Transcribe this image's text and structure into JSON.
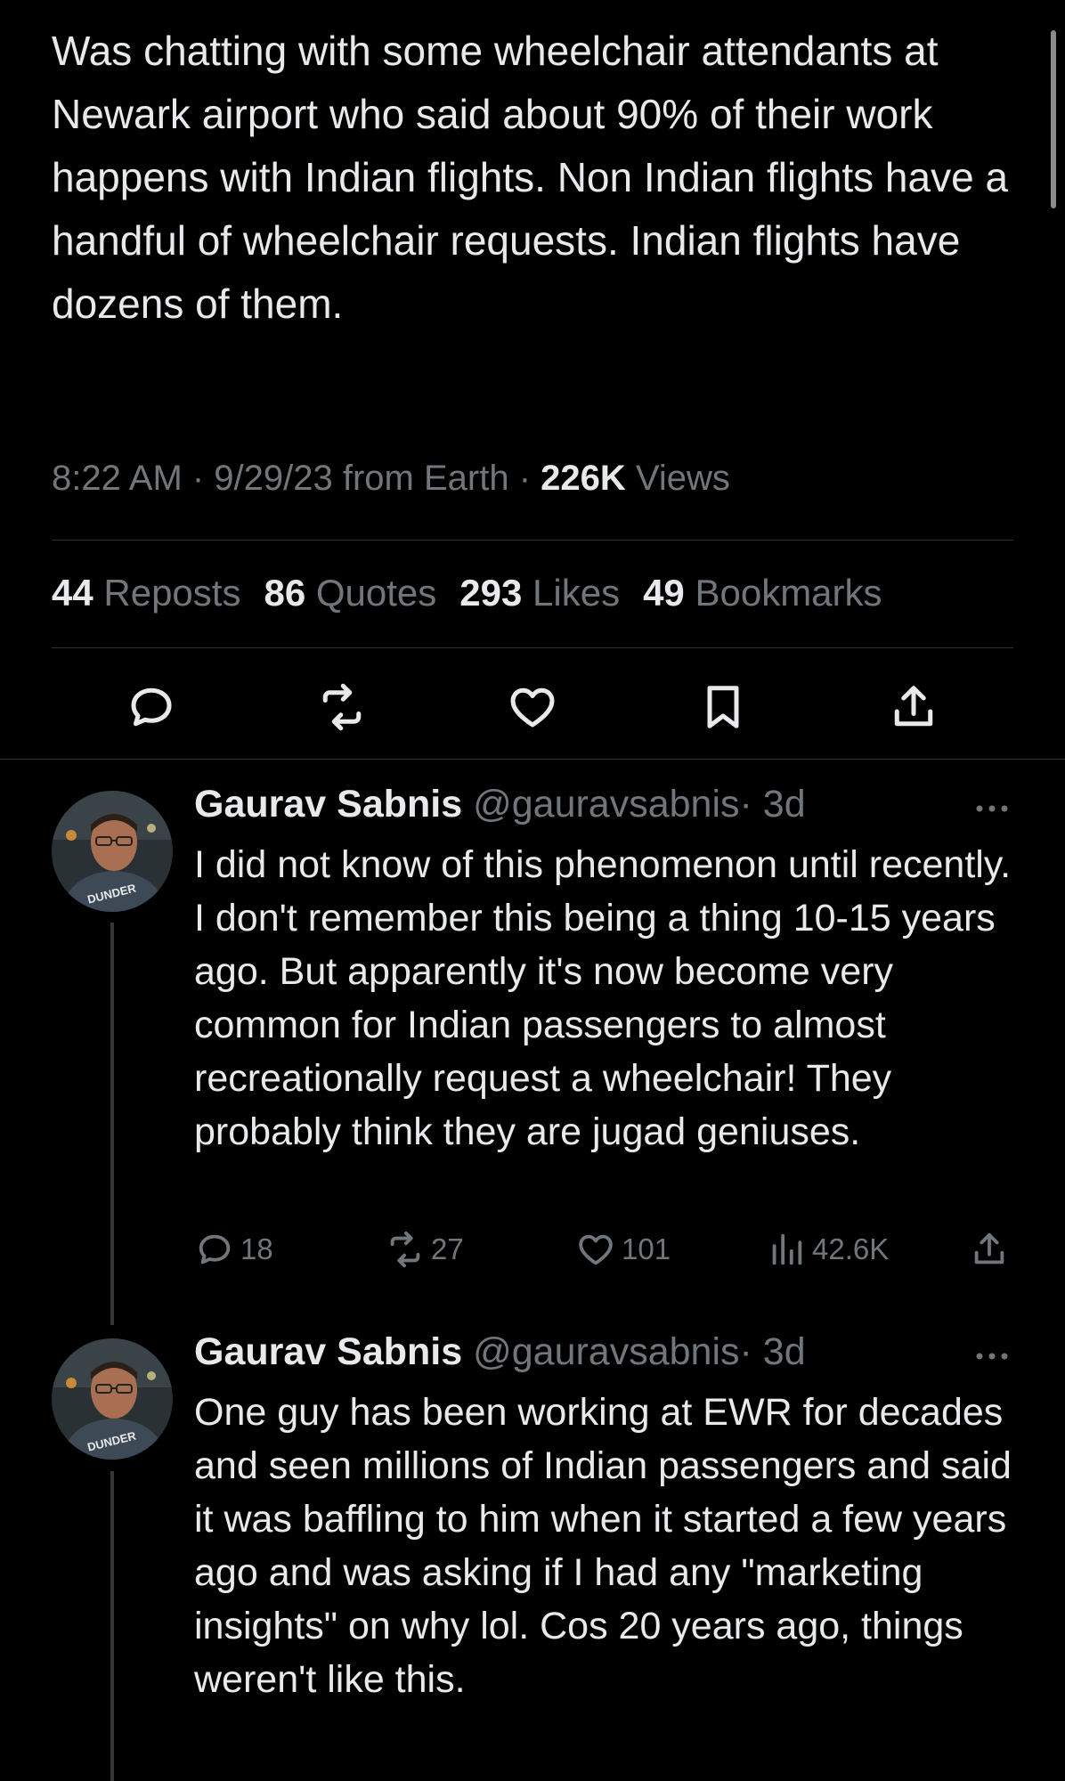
{
  "tweet": {
    "text": "Was chatting with some wheelchair attendants at Newark airport who said about 90% of their work happens with Indian flights. Non Indian flights have a handful of wheelchair requests. Indian flights have dozens of them.",
    "meta_prefix": "8:22 AM · 9/29/23 from Earth · ",
    "views_count": "226K",
    "views_label": " Views",
    "stats": {
      "reposts_count": "44",
      "reposts_label": " Reposts",
      "quotes_count": "86",
      "quotes_label": " Quotes",
      "likes_count": "293",
      "likes_label": " Likes",
      "bookmarks_count": "49",
      "bookmarks_label": " Bookmarks"
    },
    "actions": [
      "reply-icon",
      "repost-icon",
      "like-icon",
      "bookmark-icon",
      "share-icon"
    ]
  },
  "replies": [
    {
      "name": "Gaurav Sabnis",
      "handle": "@gauravsabnis",
      "time": "· 3d",
      "avatar_shirt_text": "DUNDER",
      "text": "I did not know of this phenomenon until recently. I don't remember this being a thing 10-15 years ago. But apparently it's now become very common for Indian passengers to almost recreationally request a wheelchair! They probably think they are jugad geniuses.",
      "replies_count": "18",
      "reposts_count": "27",
      "likes_count": "101",
      "views_count": "42.6K"
    },
    {
      "name": "Gaurav Sabnis",
      "handle": "@gauravsabnis",
      "time": "· 3d",
      "avatar_shirt_text": "DUNDER",
      "text": "One guy has been working at EWR for decades and seen millions of Indian passengers and said it was baffling to him when it started a few years ago and was asking if I had any \"marketing insights\" on why lol. Cos 20 years ago, things weren't like this."
    }
  ],
  "colors": {
    "background": "#000000",
    "text": "#e7e9ea",
    "secondary": "#71767b",
    "divider": "#2f3336"
  }
}
